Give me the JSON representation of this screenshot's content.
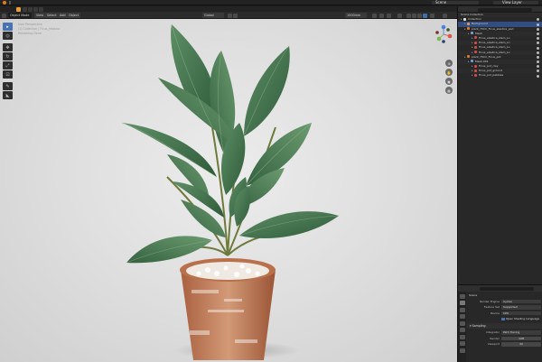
{
  "topbar": {
    "scene_label": "Scene",
    "view_layer_label": "View Layer"
  },
  "viewport_header": {
    "mode_label": "Object Mode",
    "menus": [
      "View",
      "Select",
      "Add",
      "Object"
    ],
    "transform_label": "Global",
    "zoom_label": "1000mm"
  },
  "viewport_info": {
    "line1": "User Perspective",
    "line2": "(1) Collection | Ficus_elastica",
    "line3": "Rendering Done"
  },
  "outliner": {
    "title": "Scene Collection",
    "rows": [
      {
        "label": "Collection",
        "indent": 0,
        "color": "#e5e5e5",
        "selected": false
      },
      {
        "label": "Background",
        "indent": 1,
        "color": "#cfa25e",
        "selected": true
      },
      {
        "label": "plant_75CC_Ficus_elastica_ped",
        "indent": 1,
        "color": "#e07a2e",
        "selected": false
      },
      {
        "label": "Mesh",
        "indent": 2,
        "color": "#7a9bd0",
        "selected": false
      },
      {
        "label": "Ficus_elastica_stem_Lo",
        "indent": 3,
        "color": "#d04a4a",
        "selected": false
      },
      {
        "label": "Ficus_elastica_stem_Lo",
        "indent": 3,
        "color": "#d04a4a",
        "selected": false
      },
      {
        "label": "Ficus_elastica_stem_Lo",
        "indent": 3,
        "color": "#d04a4a",
        "selected": false
      },
      {
        "label": "Ficus_elastica_stem_Lo",
        "indent": 3,
        "color": "#d04a4a",
        "selected": false
      },
      {
        "label": "plant_75CC_Ficus_pot",
        "indent": 1,
        "color": "#e07a2e",
        "selected": false
      },
      {
        "label": "Mesh.001",
        "indent": 2,
        "color": "#7a9bd0",
        "selected": false
      },
      {
        "label": "Ficus_pot_clay",
        "indent": 3,
        "color": "#d04a4a",
        "selected": false
      },
      {
        "label": "Ficus_pot_ground",
        "indent": 3,
        "color": "#d04a4a",
        "selected": false
      },
      {
        "label": "Ficus_pot_pebbles",
        "indent": 3,
        "color": "#d04a4a",
        "selected": false
      }
    ]
  },
  "properties": {
    "scene_title": "Scene",
    "render_engine_label": "Render Engine",
    "render_engine_value": "Cycles",
    "feature_set_label": "Feature Set",
    "feature_set_value": "Supported",
    "device_label": "Device",
    "device_value": "CPU",
    "osl_label": "Open Shading Language",
    "sampling_title": "Sampling",
    "integrator_label": "Integrator",
    "integrator_value": "Path Tracing",
    "render_label": "Render",
    "render_value": "128",
    "viewport_label": "Viewport",
    "viewport_value": "32"
  }
}
